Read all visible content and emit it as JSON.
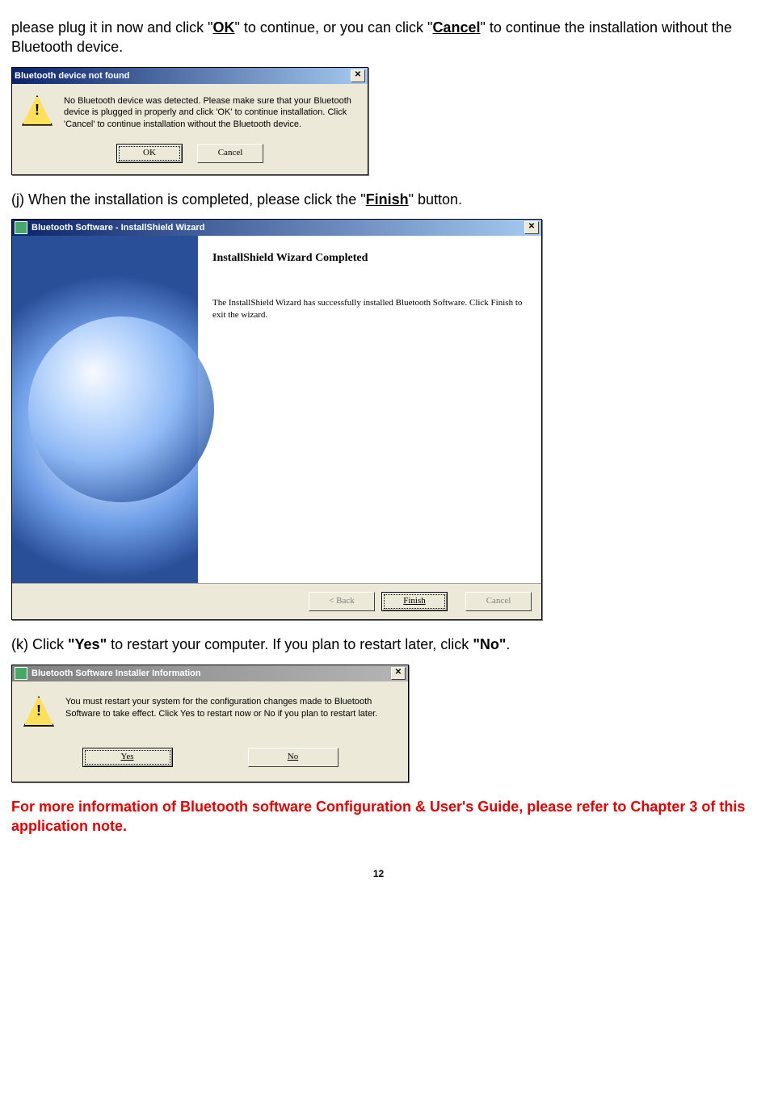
{
  "intro_text": "please plug it in now and click \"",
  "intro_ok": "OK",
  "intro_mid": "\" to continue, or you can click \"",
  "intro_cancel": "Cancel",
  "intro_end": "\" to continue the installation without the Bluetooth device.",
  "dlg1": {
    "title": "Bluetooth device not found",
    "message": "No Bluetooth device was detected. Please make sure that your Bluetooth device is plugged in properly and click 'OK' to continue installation. Click 'Cancel' to continue installation without the Bluetooth device.",
    "ok": "OK",
    "cancel": "Cancel"
  },
  "step_j_prefix": "(j) When the installation is completed, please click the \"",
  "step_j_btn": "Finish",
  "step_j_suffix": "\" button.",
  "dlg2": {
    "title": "Bluetooth Software - InstallShield Wizard",
    "heading": "InstallShield Wizard Completed",
    "message": "The InstallShield Wizard has successfully installed Bluetooth Software. Click Finish to exit the wizard.",
    "back": "< Back",
    "finish": "Finish",
    "cancel": "Cancel"
  },
  "step_k_a": "(k) Click ",
  "step_k_yes": "\"Yes\"",
  "step_k_b": " to restart your computer. If you plan to restart later, click ",
  "step_k_no": "\"No\"",
  "step_k_c": ".",
  "dlg3": {
    "title": "Bluetooth Software Installer Information",
    "message": "You must restart your system for the configuration changes made to Bluetooth Software to take effect. Click Yes to restart now or No if you plan to restart later.",
    "yes": "Yes",
    "no": "No"
  },
  "footer": " For more information of Bluetooth software Configuration & User's Guide, please refer to Chapter 3 of this application note.",
  "page": "12"
}
